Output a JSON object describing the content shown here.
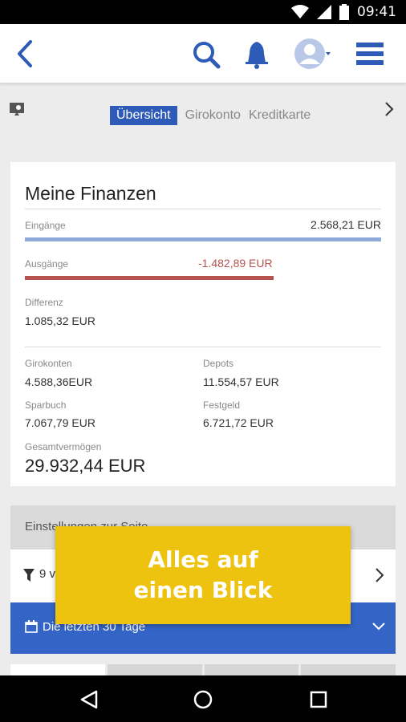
{
  "status_bar": {
    "time": "09:41",
    "icons": [
      "wifi-icon",
      "signal-icon",
      "battery-icon"
    ]
  },
  "app_bar": {
    "icons": [
      "back-arrow-icon",
      "search-icon",
      "bell-icon",
      "avatar-icon",
      "hamburger-menu-icon"
    ]
  },
  "tabs": [
    {
      "label": "Übersicht",
      "active": true
    },
    {
      "label": "Girokonto",
      "active": false
    },
    {
      "label": "Kreditkarte",
      "active": false
    }
  ],
  "finances": {
    "title": "Meine Finanzen",
    "income_label": "Eingänge",
    "income_value": "2.568,21 EUR",
    "expense_label": "Ausgänge",
    "expense_value": "-1.482,89 EUR",
    "difference_label": "Differenz",
    "difference_value": "1.085,32 EUR",
    "checking_label": "Girokonten",
    "checking_value": "4.588,36EUR",
    "depots_label": "Depots",
    "depots_value": "11.554,57 EUR",
    "savings_label": "Sparbuch",
    "savings_value": "7.067,79 EUR",
    "fixed_label": "Festgeld",
    "fixed_value": "6.721,72 EUR",
    "total_label": "Gesamtvermögen",
    "total_value": "29.932,44 EUR",
    "expense_ratio": 0.5774
  },
  "settings": {
    "title": "Einstellungen zur Seite",
    "filter_text": "9 v",
    "period_text": "Die letzten 30 Tage"
  },
  "overlay": {
    "text": "Alles auf\neinen Blick"
  },
  "colors": {
    "accent": "#2e5bb8",
    "income_bar": "#8eaad8",
    "expense_bar": "#b5534f",
    "overlay": "#edc30f"
  }
}
